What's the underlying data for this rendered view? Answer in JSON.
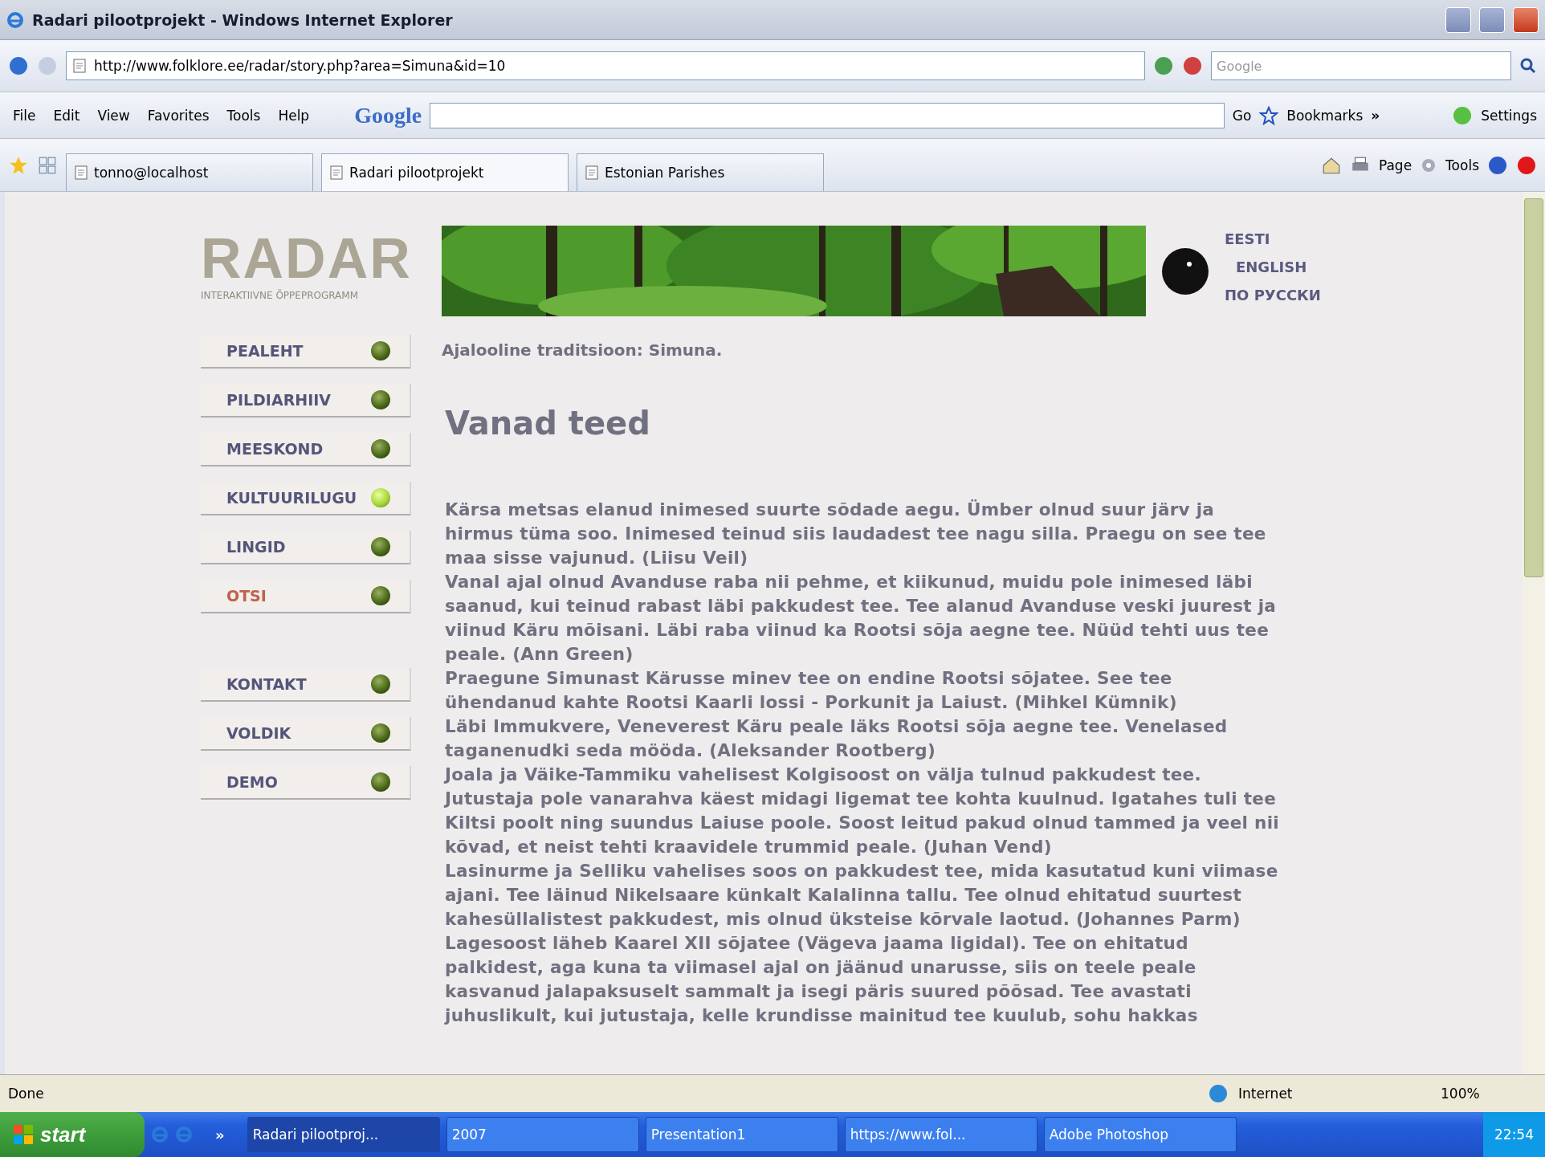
{
  "window": {
    "title": "Radari pilootprojekt - Windows Internet Explorer"
  },
  "address_bar": {
    "url": "http://www.folklore.ee/radar/story.php?area=Simuna&id=10"
  },
  "search_field": {
    "placeholder": "Google"
  },
  "menu": [
    "File",
    "Edit",
    "View",
    "Favorites",
    "Tools",
    "Help"
  ],
  "google_toolbar": {
    "logo": "Google",
    "go": "Go",
    "bookmarks": "Bookmarks",
    "more": "»",
    "settings": "Settings"
  },
  "tabs": [
    {
      "label": "tonno@localhost",
      "selected": false
    },
    {
      "label": "Radari pilootprojekt",
      "selected": true
    },
    {
      "label": "Estonian Parishes",
      "selected": false
    }
  ],
  "command_bar": {
    "page": "Page",
    "tools": "Tools"
  },
  "page": {
    "logo": {
      "title": "RADAR",
      "subtitle": "INTERAKTIIVNE ÕPPEPROGRAMM"
    },
    "nav_groups": [
      [
        {
          "label": "PEALEHT",
          "selected": false,
          "color": "#55557a"
        },
        {
          "label": "PILDIARHIIV",
          "selected": false,
          "color": "#55557a"
        },
        {
          "label": "MEESKOND",
          "selected": false,
          "color": "#55557a"
        },
        {
          "label": "KULTUURILUGU",
          "selected": true,
          "color": "#55557a"
        },
        {
          "label": "LINGID",
          "selected": false,
          "color": "#55557a"
        },
        {
          "label": "OTSI",
          "selected": false,
          "color": "#c0624a"
        }
      ],
      [
        {
          "label": "KONTAKT",
          "selected": false,
          "color": "#55557a"
        },
        {
          "label": "VOLDIK",
          "selected": false,
          "color": "#55557a"
        },
        {
          "label": "DEMO",
          "selected": false,
          "color": "#55557a"
        }
      ]
    ],
    "languages": [
      "EESTI",
      "ENGLISH",
      "ПО РУССКИ"
    ],
    "breadcrumb": "Ajalooline traditsioon: Simuna.",
    "heading": "Vanad teed",
    "paragraphs": [
      "Kärsa metsas elanud inimesed suurte sõdade aegu. Ümber olnud suur järv ja hirmus tüma soo. Inimesed teinud siis laudadest tee nagu silla. Praegu on see tee maa sisse vajunud. (Liisu Veil)",
      "Vanal ajal olnud Avanduse raba nii pehme, et kiikunud, muidu pole inimesed läbi saanud, kui teinud rabast läbi pakkudest tee. Tee alanud Avanduse veski juurest ja viinud Käru mõisani. Läbi raba viinud ka Rootsi sõja aegne tee. Nüüd tehti uus tee peale. (Ann Green)",
      "Praegune Simunast Kärusse minev tee on endine Rootsi sõjatee. See tee ühendanud kahte Rootsi Kaarli lossi - Porkunit ja Laiust. (Mihkel Kümnik)",
      "Läbi Immukvere, Veneverest Käru peale läks Rootsi sõja aegne tee. Venelased taganenudki seda mööda. (Aleksander Rootberg)",
      "Joala ja Väike-Tammiku vahelisest Kolgisoost on välja tulnud pakkudest tee. Jutustaja pole vanarahva käest midagi ligemat tee kohta kuulnud. Igatahes tuli tee Kiltsi poolt ning suundus Laiuse poole. Soost leitud pakud olnud tammed ja veel nii kõvad, et neist tehti kraavidele trummid peale. (Juhan Vend)",
      "Lasinurme ja Selliku vahelises soos on pakkudest tee, mida kasutatud kuni viimase ajani. Tee läinud Nikelsaare künkalt Kalalinna tallu. Tee olnud ehitatud suurtest kahesüllalistest pakkudest, mis olnud üksteise kõrvale laotud. (Johannes Parm)",
      "Lagesoost läheb Kaarel XII sõjatee (Vägeva jaama ligidal). Tee on ehitatud palkidest, aga kuna ta viimasel ajal on jäänud unarusse, siis on teele peale kasvanud jalapaksuselt sammalt ja isegi päris suured põõsad. Tee avastati juhuslikult, kui jutustaja, kelle krundisse mainitud tee kuulub, sohu hakkas"
    ]
  },
  "status_bar": {
    "text": "Done",
    "zone": "Internet",
    "zoom": "100%"
  },
  "taskbar": {
    "start": "start",
    "more": "»",
    "tasks": [
      {
        "label": "Radari pilootproj...",
        "selected": true
      },
      {
        "label": "2007",
        "selected": false
      },
      {
        "label": "Presentation1",
        "selected": false
      },
      {
        "label": "https://www.fol...",
        "selected": false
      },
      {
        "label": "Adobe Photoshop",
        "selected": false
      }
    ],
    "clock": "22:54"
  }
}
